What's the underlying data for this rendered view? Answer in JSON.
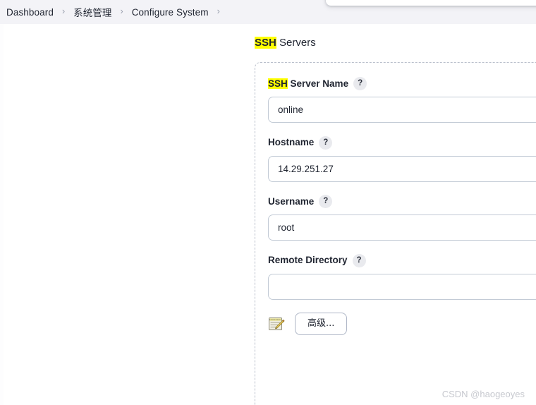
{
  "breadcrumb": {
    "name": "breadcrumb",
    "items": [
      {
        "label": "Dashboard"
      },
      {
        "label": "系统管理"
      },
      {
        "label": "Configure System"
      }
    ],
    "separator": "›"
  },
  "section": {
    "heading_highlight": "SSH",
    "heading_rest": " Servers"
  },
  "form": {
    "fields": [
      {
        "name": "ssh-server-name",
        "label_highlight": "SSH",
        "label_rest": " Server Name",
        "help": "?",
        "value": "online",
        "placeholder": ""
      },
      {
        "name": "hostname",
        "label_highlight": "",
        "label_rest": "Hostname",
        "help": "?",
        "value": "14.29.251.27",
        "placeholder": ""
      },
      {
        "name": "username",
        "label_highlight": "",
        "label_rest": "Username",
        "help": "?",
        "value": "root",
        "placeholder": ""
      },
      {
        "name": "remote-directory",
        "label_highlight": "",
        "label_rest": "Remote Directory",
        "help": "?",
        "value": "",
        "placeholder": ""
      }
    ],
    "advanced_button_label": "高级...",
    "edit_icon_name": "notepad-pencil-icon"
  },
  "watermark": {
    "text": "CSDN @haogeoyes"
  },
  "colors": {
    "breadcrumb_bar": "#f3f3f7",
    "highlight": "#ffff00",
    "text": "#1f2430",
    "input_border": "#c3cbd6",
    "dashed_border": "#b9bfcb",
    "help_badge_bg": "#e9eaee",
    "watermark": "#c7c9cf"
  }
}
